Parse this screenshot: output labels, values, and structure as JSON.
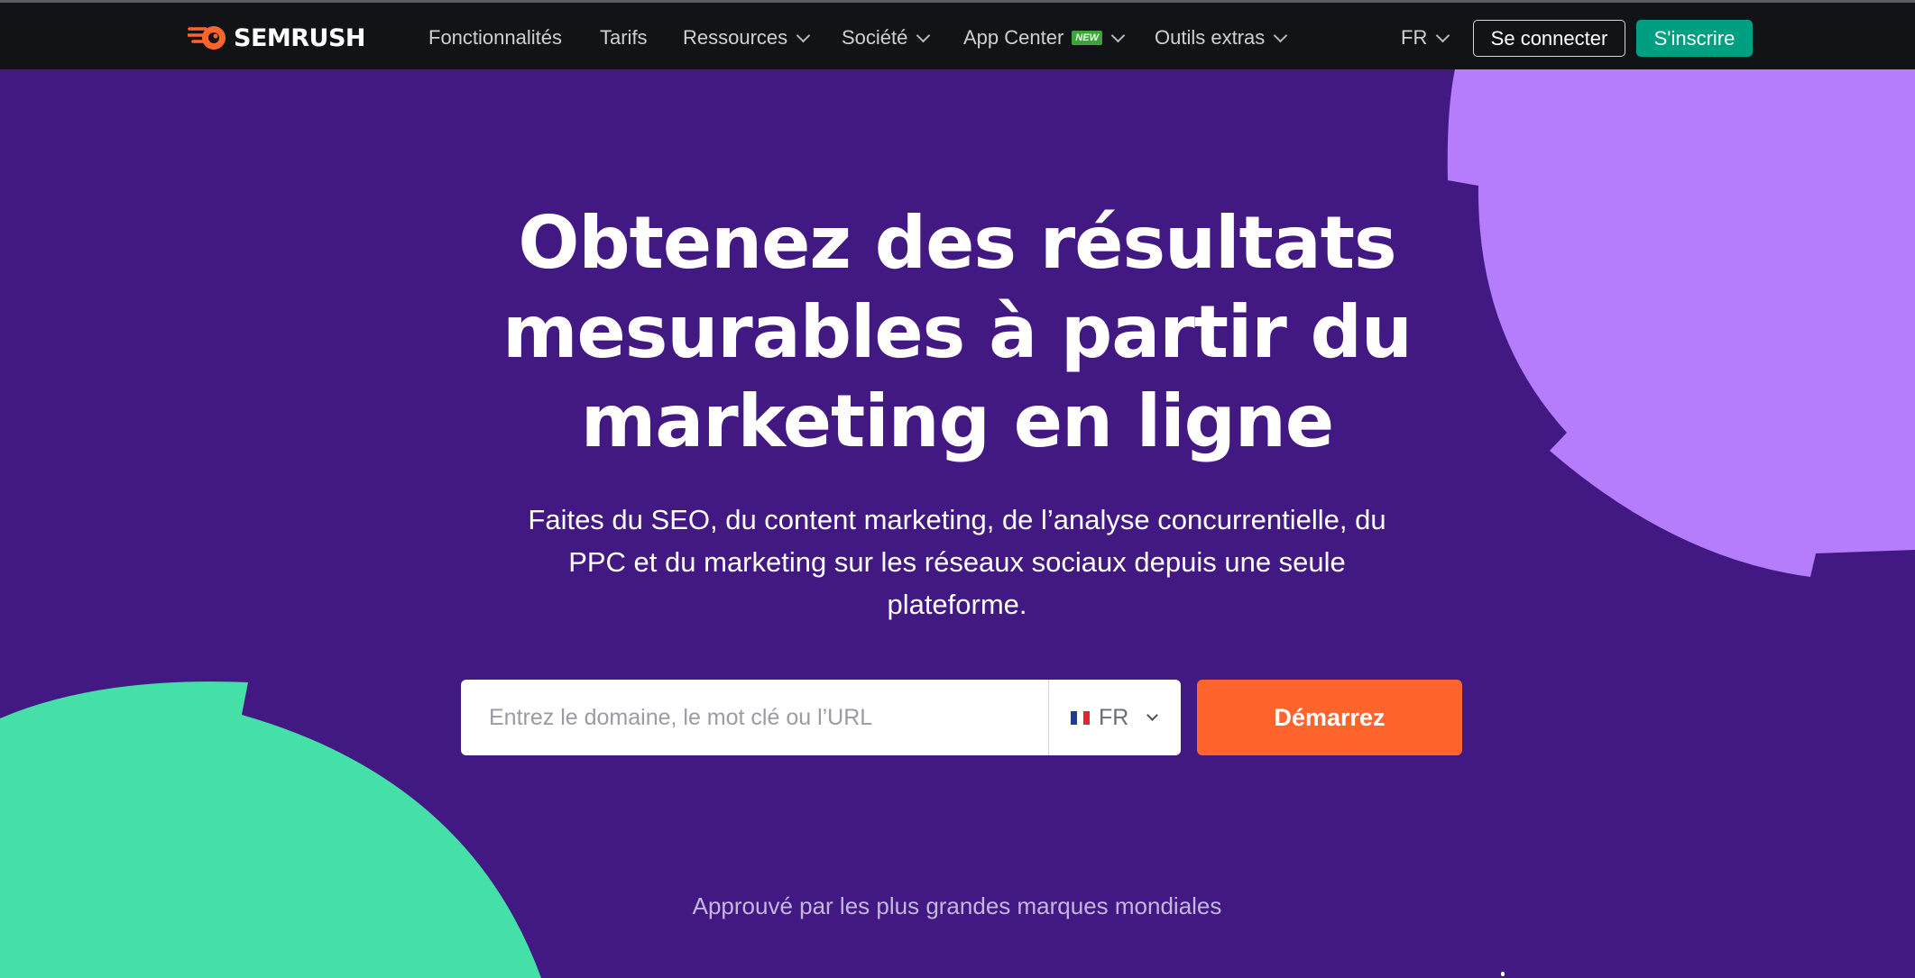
{
  "brand": {
    "name": "SEMRUSH",
    "logo_icon": "semrush-fireball-icon",
    "accent_color": "#ff642d"
  },
  "nav": {
    "items": [
      {
        "label": "Fonctionnalités",
        "has_dropdown": false
      },
      {
        "label": "Tarifs",
        "has_dropdown": false
      },
      {
        "label": "Ressources",
        "has_dropdown": true
      },
      {
        "label": "Société",
        "has_dropdown": true
      },
      {
        "label": "App Center",
        "has_dropdown": true,
        "badge": "NEW"
      },
      {
        "label": "Outils extras",
        "has_dropdown": true
      }
    ],
    "language": "FR",
    "login_label": "Se connecter",
    "signup_label": "S'inscrire"
  },
  "hero": {
    "title_lines": [
      "Obtenez des résultats",
      "mesurables à partir du",
      "marketing en ligne"
    ],
    "subtitle_lines": [
      "Faites du SEO, du content marketing, de l’analyse concurrentielle, du",
      "PPC et du marketing sur les réseaux sociaux depuis une seule",
      "plateforme."
    ]
  },
  "search": {
    "placeholder": "Entrez le domaine, le mot clé ou l’URL",
    "value": "",
    "database_label": "FR",
    "database_flag": "france-flag-icon",
    "submit_label": "Démarrez"
  },
  "trusted_text": "Approuvé par les plus grandes marques mondiales",
  "colors": {
    "hero_background": "#421983",
    "nav_background": "#121316",
    "signup_button": "#009f81",
    "start_button": "#ff642d",
    "blob_purple": "#b57dfc",
    "blob_green": "#45e0a8"
  }
}
